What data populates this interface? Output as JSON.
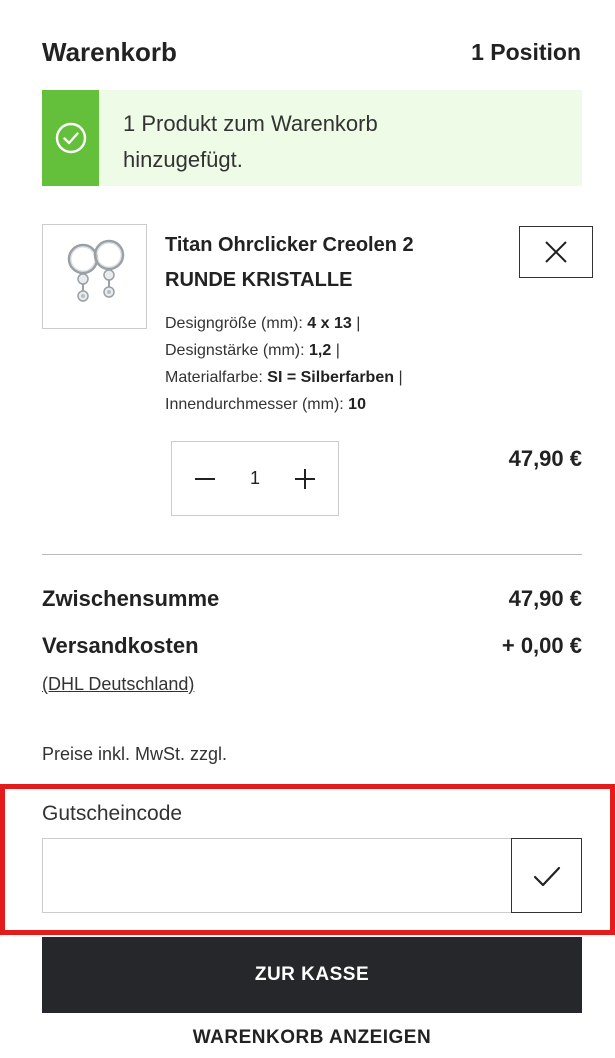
{
  "header": {
    "title": "Warenkorb",
    "count": "1 Position"
  },
  "notice": {
    "line1": "1 Produkt zum Warenkorb",
    "line2": "hinzugefügt.",
    "icon": "check-circle-icon",
    "accent": "#64c03a",
    "background": "#eefbe6"
  },
  "product": {
    "name_line1": "Titan Ohrclicker Creolen 2",
    "name_line2": "RUNDE KRISTALLE",
    "attributes": [
      {
        "label": "Designgröße (mm):",
        "value": "4 x 13",
        "sep": " |"
      },
      {
        "label": "Designstärke (mm):",
        "value": "1,2",
        "sep": " |"
      },
      {
        "label": "Materialfarbe:",
        "value": "SI = Silberfarben",
        "sep": " |"
      },
      {
        "label": "Innendurchmesser (mm):",
        "value": "10",
        "sep": ""
      }
    ],
    "quantity": "1",
    "price": "47,90 €"
  },
  "summary": {
    "subtotal_label": "Zwischensumme",
    "subtotal_value": "47,90 €",
    "shipping_label": "Versandkosten",
    "shipping_value": "+ 0,00 €",
    "carrier": "(DHL Deutschland)",
    "tax_note": "Preise inkl. MwSt. zzgl."
  },
  "coupon": {
    "label": "Gutscheincode",
    "value": "",
    "placeholder": "",
    "highlight_color": "#e31b1b"
  },
  "actions": {
    "checkout": "ZUR KASSE",
    "view_cart": "WARENKORB ANZEIGEN",
    "checkout_bg": "#25272b"
  }
}
